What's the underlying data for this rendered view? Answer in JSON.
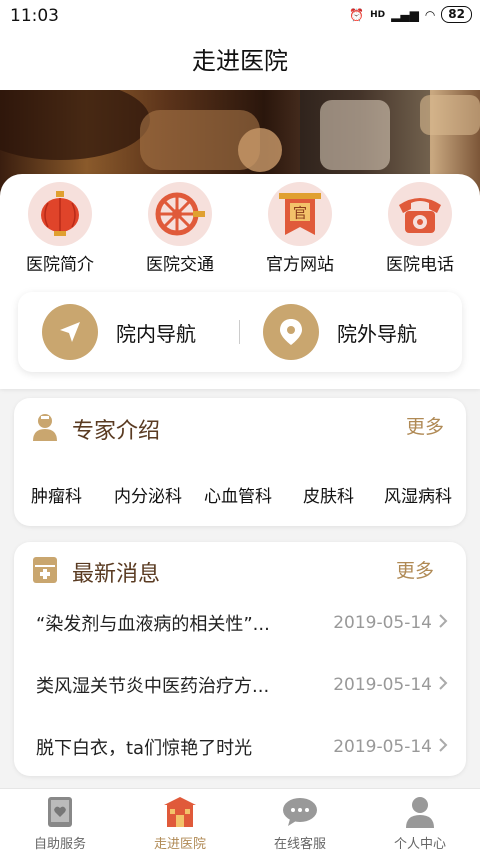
{
  "status_bar": {
    "time": "11:03",
    "signal": "HD",
    "battery": "82"
  },
  "header": {
    "title": "走进医院"
  },
  "quick_links": [
    {
      "label": "医院简介",
      "icon": "lantern-icon"
    },
    {
      "label": "医院交通",
      "icon": "wheel-icon"
    },
    {
      "label": "官方网站",
      "icon": "official-banner-icon"
    },
    {
      "label": "医院电话",
      "icon": "phone-icon"
    }
  ],
  "navigation": {
    "indoor": "院内导航",
    "outdoor": "院外导航"
  },
  "experts": {
    "title": "专家介绍",
    "more": "更多",
    "departments": [
      "肿瘤科",
      "内分泌科",
      "心血管科",
      "皮肤科",
      "风湿病科"
    ]
  },
  "news": {
    "title": "最新消息",
    "more": "更多",
    "items": [
      {
        "title": "“染发剂与血液病的相关性”...",
        "date": "2019-05-14"
      },
      {
        "title": "类风湿关节炎中医药治疗方...",
        "date": "2019-05-14"
      },
      {
        "title": "脱下白衣，ta们惊艳了时光",
        "date": "2019-05-14"
      }
    ]
  },
  "tabs": [
    {
      "label": "自助服务",
      "active": false
    },
    {
      "label": "走进医院",
      "active": true
    },
    {
      "label": "在线客服",
      "active": false
    },
    {
      "label": "个人中心",
      "active": false
    }
  ],
  "colors": {
    "accent": "#b08a55",
    "nav_circle": "#c9a66f",
    "icon_bg": "#f6e0dc",
    "icon_red": "#e05a3a"
  }
}
